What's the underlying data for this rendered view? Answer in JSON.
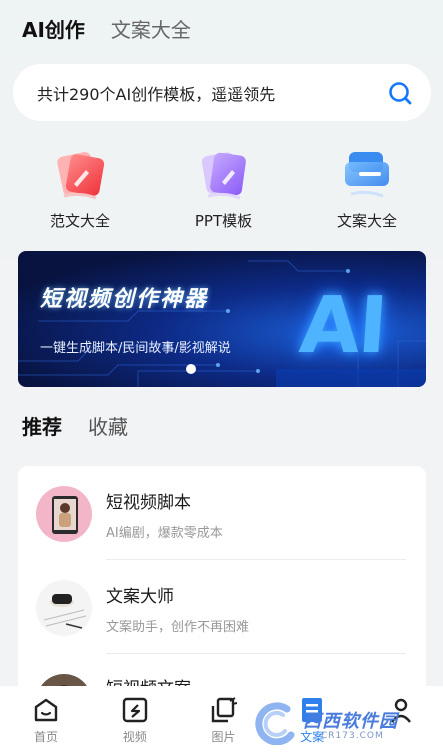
{
  "header": {
    "tabs": [
      {
        "label": "AI创作",
        "active": true
      },
      {
        "label": "文案大全",
        "active": false
      }
    ]
  },
  "search": {
    "text": "共计290个AI创作模板，遥遥领先",
    "icon": "search-icon"
  },
  "categories": [
    {
      "label": "范文大全",
      "icon": "essay-icon"
    },
    {
      "label": "PPT模板",
      "icon": "ppt-icon"
    },
    {
      "label": "文案大全",
      "icon": "copywriting-icon"
    }
  ],
  "banner": {
    "title": "短视频创作神器",
    "subtitle": "一键生成脚本/民间故事/影视解说",
    "logo_text": "AI",
    "pages": 1,
    "current_page": 1
  },
  "section_tabs": [
    {
      "label": "推荐",
      "active": true
    },
    {
      "label": "收藏",
      "active": false
    }
  ],
  "list": [
    {
      "title": "短视频脚本",
      "subtitle": "AI编剧，爆款零成本"
    },
    {
      "title": "文案大师",
      "subtitle": "文案助手，创作不再困难"
    },
    {
      "title": "短视频文案",
      "subtitle": ""
    }
  ],
  "bottom_nav": [
    {
      "label": "首页",
      "icon": "home-icon"
    },
    {
      "label": "视频",
      "icon": "video-icon"
    },
    {
      "label": "图片",
      "icon": "image-icon"
    },
    {
      "label": "文案",
      "icon": "document-icon"
    },
    {
      "label": "",
      "icon": "profile-icon"
    }
  ],
  "watermark": {
    "text": "西西软件园",
    "domain": "CR173.COM"
  },
  "colors": {
    "accent": "#1677ff",
    "banner_bg": "#0d2a86",
    "watermark": "#4a7cdc"
  }
}
